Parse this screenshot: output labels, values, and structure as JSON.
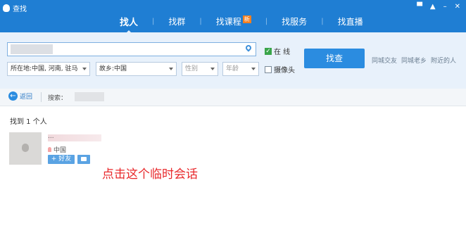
{
  "window": {
    "title": "查找",
    "controls": [
      "▀",
      "▲",
      "–",
      "✕"
    ]
  },
  "tabs": [
    {
      "label": "找人",
      "active": true
    },
    {
      "label": "找群"
    },
    {
      "label": "找课程",
      "badge": "新"
    },
    {
      "label": "找服务"
    },
    {
      "label": "找直播"
    }
  ],
  "search": {
    "online_label": "在 线",
    "online_checked": true,
    "camera_label": "摄像头",
    "camera_checked": false,
    "find_button": "找查",
    "quick_links": [
      "同城交友",
      "同城老乡",
      "附近的人"
    ],
    "location": "所在地:中国, 河南, 驻马",
    "hometown": "故乡:中国",
    "gender_placeholder": "性别",
    "age_placeholder": "年龄"
  },
  "nav": {
    "back_label": "返回",
    "search_label": "搜索："
  },
  "results": {
    "count_text": "找到 1 个人",
    "person": {
      "name": "...",
      "location": "中国",
      "add_friend": "+ 好友"
    }
  },
  "annotation": "点击这个临时会话"
}
